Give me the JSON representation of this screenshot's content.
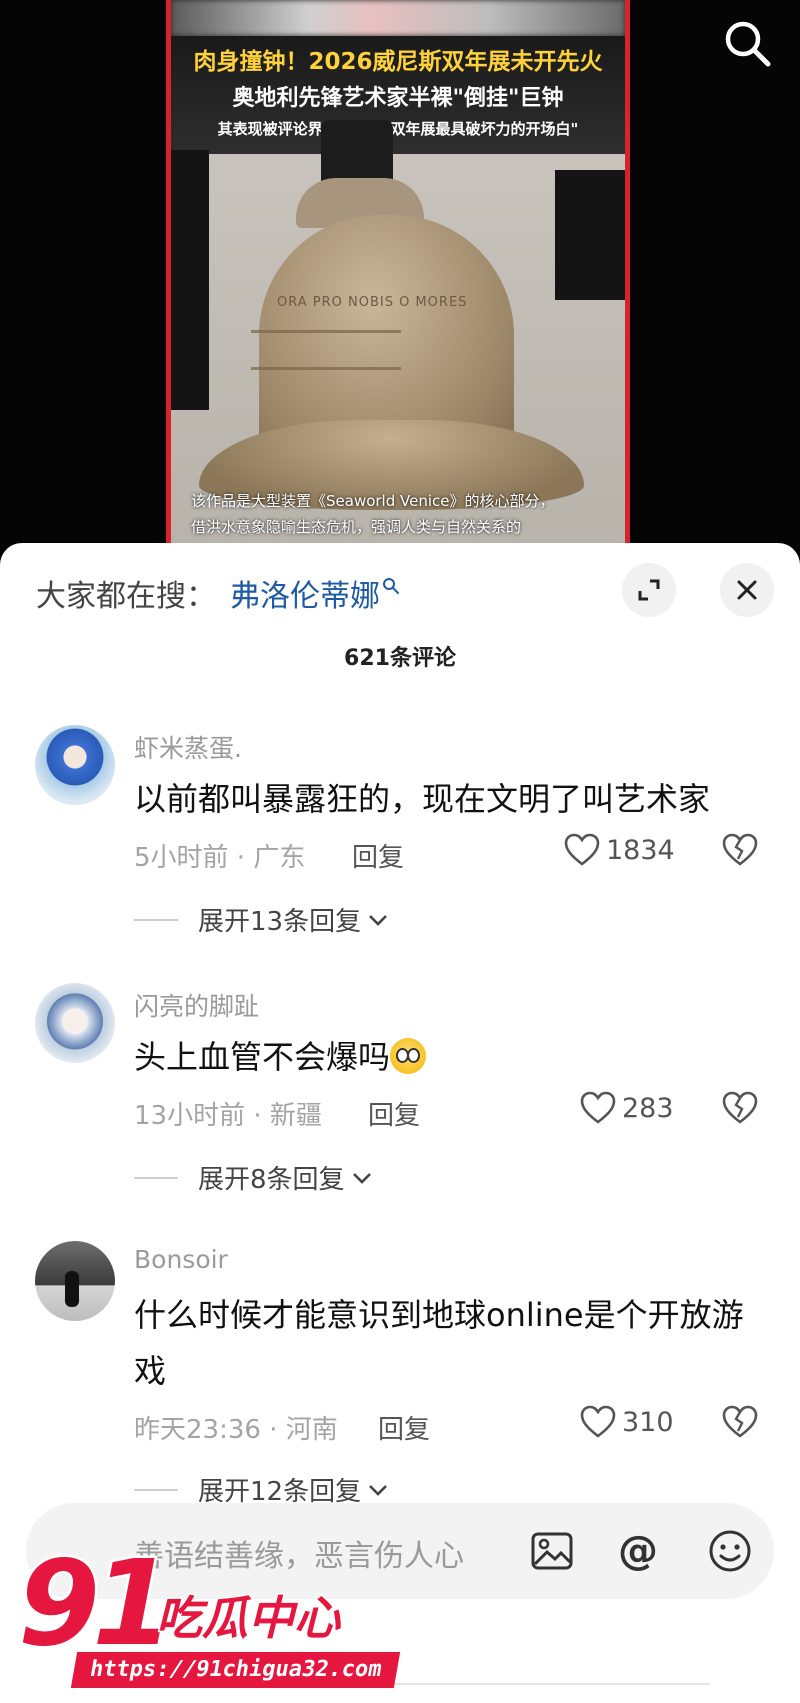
{
  "video": {
    "headline_line1": "肉身撞钟！2026威尼斯双年展未开先火",
    "headline_line2": "奥地利先锋艺术家半裸\"倒挂\"巨钟",
    "headline_line3": "其表现被评论界誉为\"本届双年展最具破坏力的开场白\"",
    "bell_inscription": "ORA PRO NOBIS O MORES",
    "caption_line1": "该作品是大型装置《Seaworld Venice》的核心部分，",
    "caption_line2": "借洪水意象隐喻生态危机，强调人类与自然关系的"
  },
  "sheet": {
    "hot_search_label": "大家都在搜：",
    "hot_search_keyword": "弗洛伦蒂娜",
    "comment_count": "621条评论"
  },
  "comments": [
    {
      "username": "虾米蒸蛋.",
      "content": "以前都叫暴露狂的，现在文明了叫艺术家",
      "meta": "5小时前 · 广东",
      "reply_label": "回复",
      "likes": "1834",
      "expand_label": "展开13条回复"
    },
    {
      "username": "闪亮的脚趾",
      "content": "头上血管不会爆吗",
      "meta": "13小时前 · 新疆",
      "reply_label": "回复",
      "likes": "283",
      "expand_label": "展开8条回复"
    },
    {
      "username": "Bonsoir",
      "content": "什么时候才能意识到地球online是个开放游戏",
      "meta": "昨天23:36 · 河南",
      "reply_label": "回复",
      "likes": "310",
      "expand_label": "展开12条回复"
    }
  ],
  "input_bar": {
    "placeholder": "善语结善缘，恶言伤人心"
  },
  "watermark": {
    "number": "91",
    "title": "吃瓜中心",
    "url": "https://91chigua32.com"
  },
  "colors": {
    "accent_red": "#e5173f",
    "keyword_blue": "#1f5aa3",
    "headline_yellow": "#ffd23a"
  }
}
